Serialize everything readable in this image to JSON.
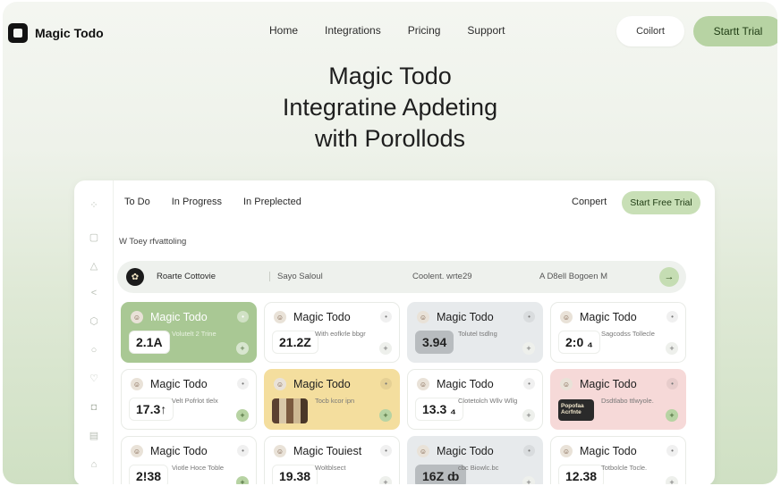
{
  "brand": {
    "name": "Magic Todo"
  },
  "nav": {
    "items": [
      "Home",
      "Integrations",
      "Pricing",
      "Support"
    ]
  },
  "header": {
    "contact_label": "Coilort",
    "trial_label": "Startt Trial"
  },
  "hero": {
    "line1": "Magic Todo",
    "line2": "Integratine Apdeting",
    "line3": "with Porollods"
  },
  "dashboard": {
    "tabs": [
      "To Do",
      "In Progress",
      "In Preplected"
    ],
    "convert_label": "Conpert",
    "trial_label": "Start Free Trial",
    "subtitle": "W Toey rfvattoling",
    "filter": {
      "items": [
        "Roarte Cottovie",
        "Sayo Saloul",
        "Coolent. wrte29",
        "A D8ell Bogoen M"
      ]
    },
    "cards": [
      {
        "title": "Magic Todo",
        "value": "2.1A",
        "desc": "Volutelt 2 Trine",
        "style": "green"
      },
      {
        "title": "Magic Todo",
        "value": "21.2Z",
        "desc": "With eofkrle bbgr",
        "style": "white"
      },
      {
        "title": "Magic Todo",
        "value": "3.94",
        "desc": "Tolutel tsdlng",
        "style": "grey"
      },
      {
        "title": "Magic Todo",
        "value": "2:0 ₄",
        "desc": "Sagcodss Tollecle",
        "style": "white"
      },
      {
        "title": "Magic Todo",
        "value": "17.3↑",
        "desc": "Velt Pofrlot tlelx",
        "style": "white"
      },
      {
        "title": "Magic Todo",
        "value": "",
        "desc": "Tocb kcor ipn",
        "style": "yellow"
      },
      {
        "title": "Magic Todo",
        "value": "13.3 ₄",
        "desc": "Clotetolch Wllv Wllg",
        "style": "white"
      },
      {
        "title": "Magic Todo",
        "value": "",
        "desc": "Dsdtlabo ttlwyole.",
        "style": "pink",
        "badge": "Popofaa\nAcrfnte"
      },
      {
        "title": "Magic Todo",
        "value": "2!38",
        "desc": "Viotle Hoce Toble",
        "style": "white"
      },
      {
        "title": "Magic Touiest",
        "value": "19.38",
        "desc": "Woltblsect",
        "style": "white"
      },
      {
        "title": "Magic Todo",
        "value": "16Z ȸ",
        "desc": "cbc Biowlc.bc",
        "style": "grey"
      },
      {
        "title": "Magic Todo",
        "value": "12.38",
        "desc": "Totbolcle Tocle.",
        "style": "white"
      }
    ]
  },
  "colors": {
    "accent_green": "#a9c894",
    "button_green": "#b7d3a3",
    "yellow": "#f4de9e",
    "pink": "#f6d9d8",
    "grey": "#e7eaec"
  }
}
